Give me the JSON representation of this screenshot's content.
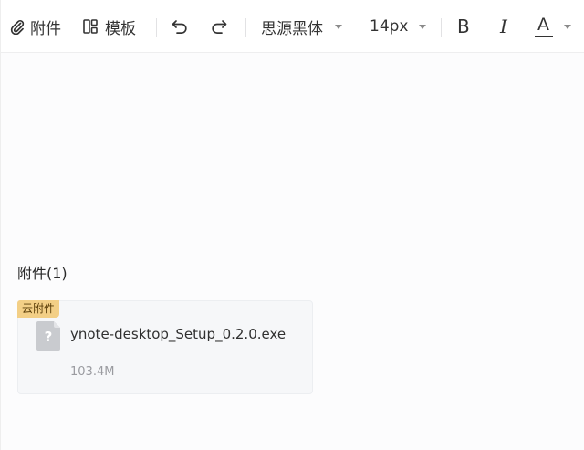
{
  "toolbar": {
    "attachment_label": "附件",
    "template_label": "模板",
    "font_family": "思源黑体",
    "font_size": "14px",
    "bold_label": "B",
    "italic_label": "I",
    "font_color_label": "A",
    "icons": {
      "attachment": "paperclip-icon",
      "template": "template-icon",
      "undo": "undo-icon",
      "redo": "redo-icon",
      "font_family_dropdown": "caret-down-icon",
      "font_size_dropdown": "caret-down-icon",
      "font_color_dropdown": "caret-down-icon"
    }
  },
  "attachments": {
    "title": "附件(1)",
    "items": [
      {
        "badge": "云附件",
        "name": "ynote-desktop_Setup_0.2.0.exe",
        "size": "103.4M",
        "icon": "unknown-file-icon",
        "icon_glyph": "?"
      }
    ]
  },
  "colors": {
    "badge_bg": "#f3cf86",
    "card_bg": "#f6f7f9",
    "page_bg": "#fcfcfd",
    "file_icon": "#c9cbcf"
  }
}
